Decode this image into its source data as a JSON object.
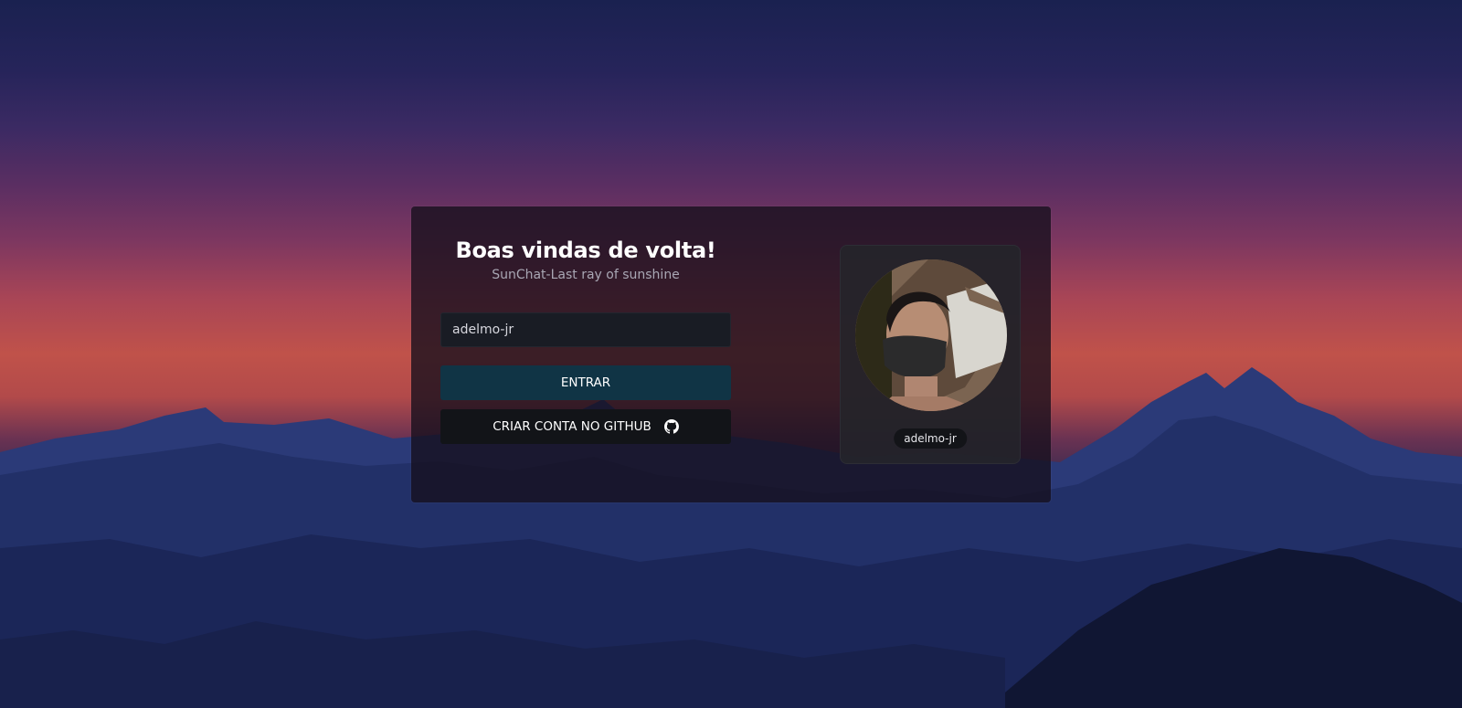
{
  "login": {
    "title": "Boas vindas de volta!",
    "subtitle": "SunChat-Last ray of sunshine",
    "username_value": "adelmo-jr",
    "enter_label": "ENTRAR",
    "github_label": "CRIAR CONTA NO GITHUB",
    "github_icon": "github-icon"
  },
  "profile": {
    "username": "adelmo-jr",
    "avatar_icon": "user-photo"
  },
  "colors": {
    "card_bg": "#16101c",
    "enter_button": "#103445",
    "github_button": "#121418",
    "input_bg": "#191c24",
    "profile_bg": "#24242a"
  }
}
